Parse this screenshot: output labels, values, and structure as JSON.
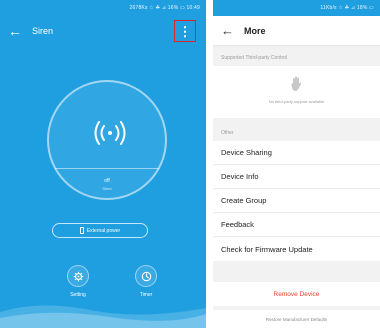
{
  "left_screen": {
    "status_text": "2678Ks ☆ ☘ ⊿ 16% ▭ 10:49",
    "title": "Siren",
    "state": "off",
    "state_sub": "Siren",
    "power_label": "External power",
    "setting_label": "Setting",
    "timer_label": "Timer",
    "icons": {
      "back": "back-arrow-icon",
      "menu": "more-vertical-icon",
      "siren": "wave-signal-icon",
      "battery": "battery-icon",
      "setting": "gear-icon",
      "timer": "clock-icon"
    }
  },
  "right_screen": {
    "status_text": "11Kb/s ☆ ☘ ⊿ 18% ▭",
    "title": "More",
    "supported_label": "Supported Third-party Control",
    "supported_note": "No third-party support available",
    "other_label": "Other",
    "menu_items": [
      "Device Sharing",
      "Device Info",
      "Create Group",
      "Feedback",
      "Check for Firmware Update"
    ],
    "remove_label": "Remove Device",
    "restore_label": "Restore Manufacturer Defaults"
  },
  "colors": {
    "primary_blue": "#1f9fe0",
    "highlight_red": "#e0242a",
    "danger_red": "#e8412e"
  }
}
